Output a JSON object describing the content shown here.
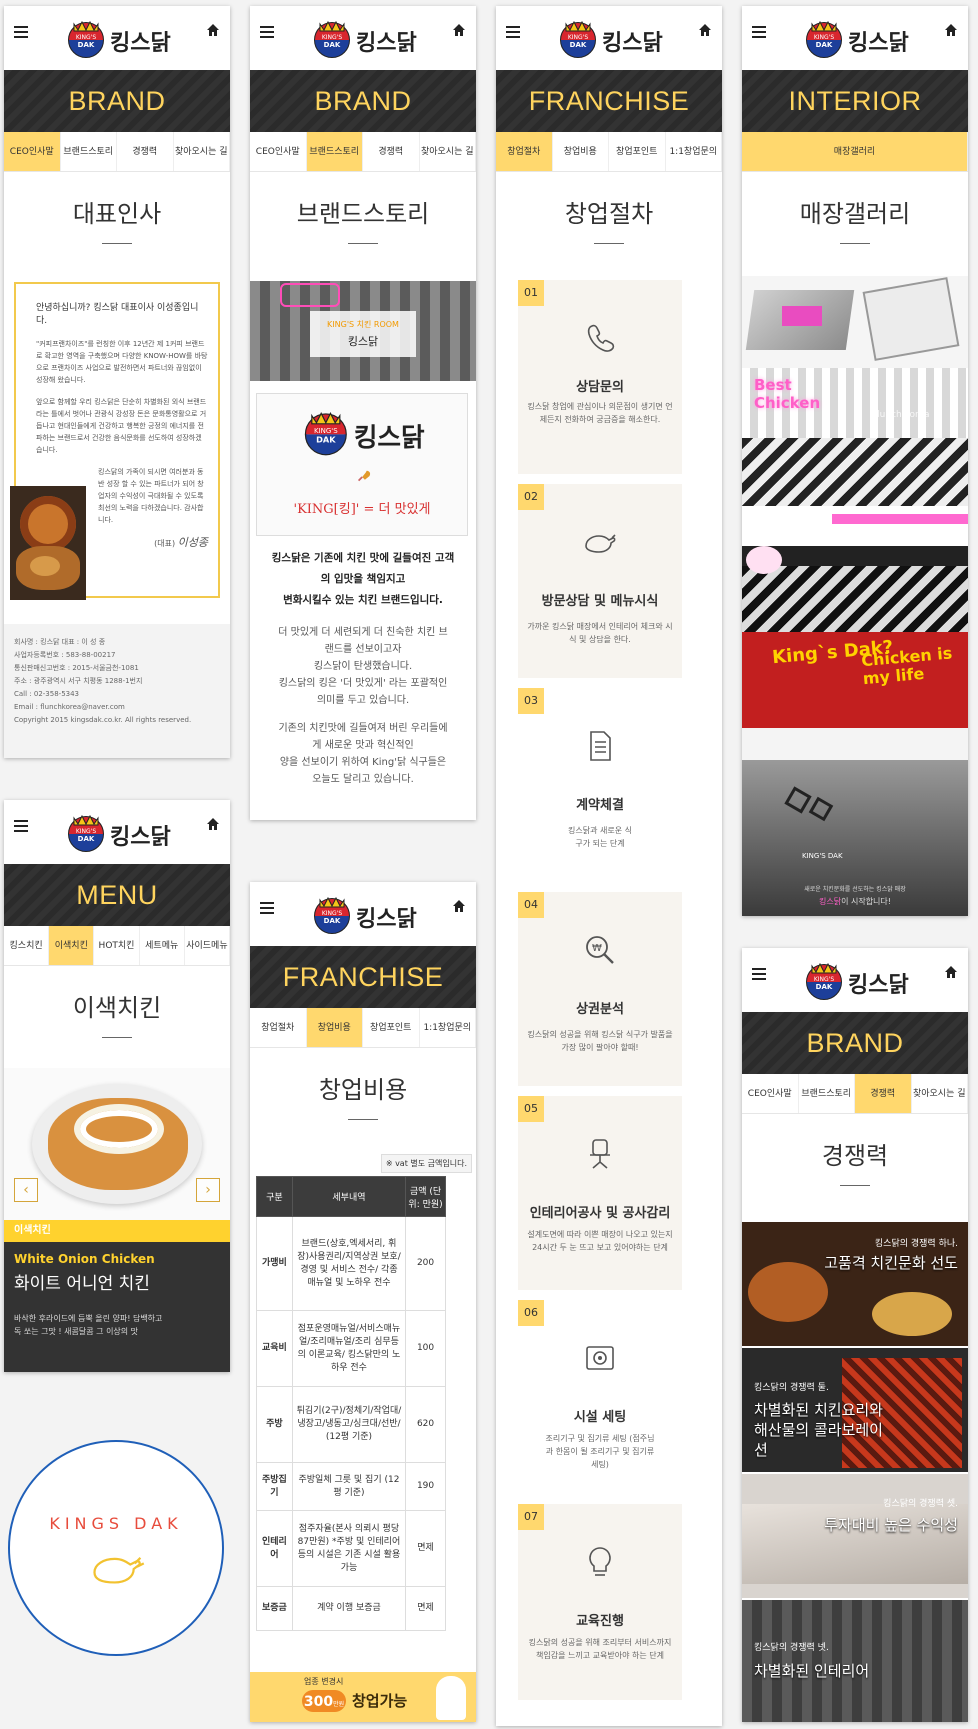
{
  "logo": {
    "top": "KING'S",
    "mid": "DAK",
    "brand": "킹스닭"
  },
  "brand_hero": "BRAND",
  "franchise_hero": "FRANCHISE",
  "interior_hero": "INTERIOR",
  "menu_hero": "MENU",
  "brand_tabs": [
    "CEO인사말",
    "브랜드스토리",
    "경쟁력",
    "찾아오시는 길"
  ],
  "franchise_tabs": [
    "창업절차",
    "창업비용",
    "창업포인트",
    "1:1창업문의"
  ],
  "interior_tabs": [
    "매장갤러리"
  ],
  "menu_tabs": [
    "킹스치킨",
    "이색치킨",
    "HOT치킨",
    "세트메뉴",
    "사이드메뉴"
  ],
  "s1": {
    "title": "대표인사",
    "greeting": "안녕하십니까? 킹스닭 대표이사 이성종입니다.",
    "p1": "\"커피프랜차이즈\"를 런칭한 이후 12년간 제 1커피 브랜드로 확고한 영역을 구축했으며 다양한 KNOW-HOW를 바탕으로 프랜차이즈 사업으로 발전하면서 파트너와 끊임없이 성장해 왔습니다.",
    "p2": "앞으로 함께할 우리 킹스닭은 단순히 차별화된 외식 브랜드라는 틀에서 벗어나 관광식 강성장 돈은 문화통영활으로 거듭나고 현대인들에게 건강하고 행복한 긍정의 에너지를 전파하는 브랜드로서 건강한 음식문화를 선도하여 성장하겠습니다.",
    "p3": "킹스닭의 가족이 되시면 여러분과 동반 성장 할 수 있는 파트너가 되어 창업자의 수익성이 극대화될 수 있도록 최선의 노력을 다하겠습니다. 감사합니다.",
    "sign_label": "(대표)",
    "sign_name": "이성종",
    "footer": [
      "회사명 : 킹스닭     대표 : 이 성 종",
      "사업자등록번호 : 583-88-00217",
      "통신판매신고번호 : 2015-서울금천-1081",
      "주소 : 광주광역시 서구 치평동 1288-1번지",
      "Call : 02-358-5343",
      "Email : flunchkorea@naver.com",
      "Copyright 2015 kingsdak.co.kr. All rights reserved."
    ]
  },
  "s2": {
    "title": "브랜드스토리",
    "photo_sub": "KING'S 치킨 ROOM",
    "photo_title": "킹스닭",
    "king_text": "'KING[킹]' = 더 맛있게",
    "bold": [
      "킹스닭은 기존에 치킨 맛에 길들여진 고객",
      "의 입맛을 책임지고",
      "변화시킬수 있는 치킨 브랜드입니다."
    ],
    "p1": [
      "더 맛있게 더 세련되게 더 친숙한 치킨 브",
      "랜드를 선보이고자",
      "킹스닭이 탄생했습니다.",
      "킹스닭의 킹은 '더 맛있게' 라는 포괄적인",
      "의미를 두고 있습니다."
    ],
    "p2": [
      "기존의 치킨맛에 길들여져 버린 우리들에",
      "게 새로운 맛과 혁신적인",
      "양을 선보이기 위하여 King'닭 식구들은",
      "오늘도 달리고 있습니다."
    ]
  },
  "s3": {
    "title": "창업절차",
    "steps": [
      {
        "num": "01",
        "title": "상담문의",
        "desc": "킹스닭 창업에 관심이나 의문점이 생기면 언제든지 전화하여 궁금증을 해소한다.",
        "icon": "phone-icon"
      },
      {
        "num": "02",
        "title": "방문상담 및 메뉴시식",
        "desc": "가까운 킹스닭 매장에서 인테리어 체크와 시식 및 상담을 한다.",
        "icon": "chicken-icon"
      },
      {
        "num": "03",
        "title": "계약체결",
        "desc": "킹스닭과 새로운 식구가 되는 단계",
        "icon": "document-icon"
      },
      {
        "num": "04",
        "title": "상권분석",
        "desc": "킹스닭의 성공을 위해 킹스닭 식구가 발품을 가장 많이 팔아야 할때!",
        "icon": "magnifier-won-icon"
      },
      {
        "num": "05",
        "title": "인테리어공사 및 공사감리",
        "desc": "설계도면에 따라 이쁜 매장이 나오고 있는지 24시간 두 눈 뜨고 보고 있어야하는 단계",
        "icon": "chair-icon"
      },
      {
        "num": "06",
        "title": "시설 세팅",
        "desc": "조리기구 및 집기류 세팅 (점주님과 한몸이 될 조리기구 및 집기류 세팅)",
        "icon": "safe-icon"
      },
      {
        "num": "07",
        "title": "교육진행",
        "desc": "킹스닭의 성공을 위해 조리부터 서비스까지 책임감을 느끼고 교육받아야 하는 단계",
        "icon": "lightbulb-icon"
      }
    ]
  },
  "s4": {
    "title": "매장갤러리",
    "neon1": "Best Chicken",
    "watermark": "Flunch korea",
    "wall_sign1": "King`s Dak?",
    "wall_sign2": "Chicken is my life",
    "sign": "KING'S DAK",
    "caption": "이 시작합니다!",
    "caption_brand": "킹스닭",
    "caption_pre": "새로운 치킨문화를 선도하는 킹스닭 매장"
  },
  "s5": {
    "title": "이색치킨",
    "label": "이색치킨",
    "name_en": "White Onion Chicken",
    "name_ko": "화이트 어니언 치킨",
    "desc": [
      "바삭한 후라이드에 듬뿍 올린 양파! 담백하고",
      "독 쏘는 그맛 ! 새콤달콤 그 이상의 맛"
    ]
  },
  "s6": {
    "title": "창업비용",
    "note": "※ vat 별도 금액입니다.",
    "headers": [
      "구분",
      "세부내역",
      "금액 (단위: 만원)"
    ],
    "rows": [
      {
        "k": "가맹비",
        "d": "브랜드(상호,엑세서리, 휘장)사용권리/지역상권 보호/경영 및 서비스 전수/ 각종 매뉴얼 및 노하우 전수",
        "v": "200"
      },
      {
        "k": "교육비",
        "d": "점포운영매뉴얼/서비스매뉴얼/조리매뉴얼/조리 심무등의 이론교육/ 킹스닭만의 노하우 전수",
        "v": "100"
      },
      {
        "k": "주방",
        "d": "튀김기(2구)/정체기/작업대/냉장고/냉동고/싱크대/선반/ (12평 기준)",
        "v": "620"
      },
      {
        "k": "주방집기",
        "d": "주방일체 그릇 및 집기 (12평 기준)",
        "v": "190"
      },
      {
        "k": "인테리어",
        "d": "점주자율(본사 의뢰시 평당 87만원) *주방 및 인테리어 등의 시설은 기존 시설 활용 가능",
        "v": "면제"
      },
      {
        "k": "보증금",
        "d": "계약 이행 보증금",
        "v": "면제"
      }
    ],
    "banner_small": "업종 변경시",
    "banner_num": "300",
    "banner_unit": "만원",
    "banner_text": "창업가능"
  },
  "s7": {
    "title": "경쟁력",
    "items": [
      {
        "sub": "킹스닭의 경쟁력 하나.",
        "title": "고품격 치킨문화 선도"
      },
      {
        "sub": "킹스닭의 경쟁력 둘.",
        "title": "차별화된 치킨요리와 해산물의 콜라보레이션"
      },
      {
        "sub": "킹스닭의 경쟁력 셋.",
        "title": "투자대비 높은 수익성"
      },
      {
        "sub": "킹스닭의 경쟁력 넷.",
        "title": "차별화된 인테리어"
      }
    ]
  },
  "badge": {
    "text": "KINGS DAK",
    "icon": "chicken-icon"
  },
  "colors": {
    "accent": "#ffd86e",
    "hero_bg": "#2f2f2f",
    "hero_text": "#ffd45e",
    "menu_label": "#ffd22e"
  }
}
